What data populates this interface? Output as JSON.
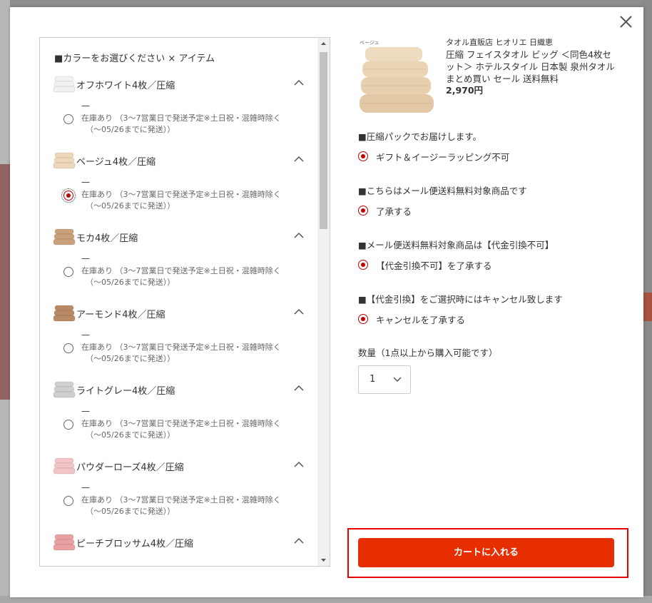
{
  "modal": {
    "close_label": "×"
  },
  "left": {
    "section_title": "■カラーをお選びください × アイテム",
    "items": [
      {
        "name": "オフホワイト4枚／圧縮",
        "dash": "—",
        "stock_line1": "在庫あり （3～7営業日で発送予定※土日祝・混雑時除く",
        "stock_line2": "（～05/26までに発送））",
        "selected": false,
        "color": "#f1f1ef"
      },
      {
        "name": "ベージュ4枚／圧縮",
        "dash": "—",
        "stock_line1": "在庫あり （3～7営業日で発送予定※土日祝・混雑時除く",
        "stock_line2": "（～05/26までに発送））",
        "selected": true,
        "color": "#ecd7b8"
      },
      {
        "name": "モカ4枚／圧縮",
        "dash": "—",
        "stock_line1": "在庫あり （3～7営業日で発送予定※土日祝・混雑時除く",
        "stock_line2": "（～05/26までに発送））",
        "selected": false,
        "color": "#c9a07a"
      },
      {
        "name": "アーモンド4枚／圧縮",
        "dash": "—",
        "stock_line1": "在庫あり （3～7営業日で発送予定※土日祝・混雑時除く",
        "stock_line2": "（～05/26までに発送））",
        "selected": false,
        "color": "#b88a66"
      },
      {
        "name": "ライトグレー4枚／圧縮",
        "dash": "—",
        "stock_line1": "在庫あり （3～7営業日で発送予定※土日祝・混雑時除く",
        "stock_line2": "（～05/26までに発送））",
        "selected": false,
        "color": "#cfcfcf"
      },
      {
        "name": "パウダーローズ4枚／圧縮",
        "dash": "—",
        "stock_line1": "在庫あり （3～7営業日で発送予定※土日祝・混雑時除く",
        "stock_line2": "（～05/26までに発送））",
        "selected": false,
        "color": "#f2c4c8"
      },
      {
        "name": "ピーチブロッサム4枚／圧縮",
        "dash": "",
        "stock_line1": "",
        "stock_line2": "",
        "selected": false,
        "color": "#e8a0a0"
      }
    ]
  },
  "product": {
    "shop": "タオル直販店 ヒオリエ 日織恵",
    "name": "圧縮 フェイスタオル ビッグ ＜同色4枚セット＞ ホテルスタイル 日本製 泉州タオル まとめ買い セール 送料無料",
    "price": "2,970円",
    "image_label": "ベージュ"
  },
  "options": [
    {
      "question": "■圧縮パックでお届けします。",
      "answer": "ギフト＆イージーラッピング不可"
    },
    {
      "question": "■こちらはメール便送料無料対象商品です",
      "answer": "了承する"
    },
    {
      "question": "■メール便送料無料対象商品は【代金引換不可】",
      "answer": "【代金引換不可】を了承する"
    },
    {
      "question": "■【代金引換】をご選択時にはキャンセル致します",
      "answer": "キャンセルを了承する"
    }
  ],
  "quantity": {
    "label": "数量（1点以上から購入可能です）",
    "value": "1"
  },
  "cart": {
    "button_label": "カートに入れる"
  }
}
